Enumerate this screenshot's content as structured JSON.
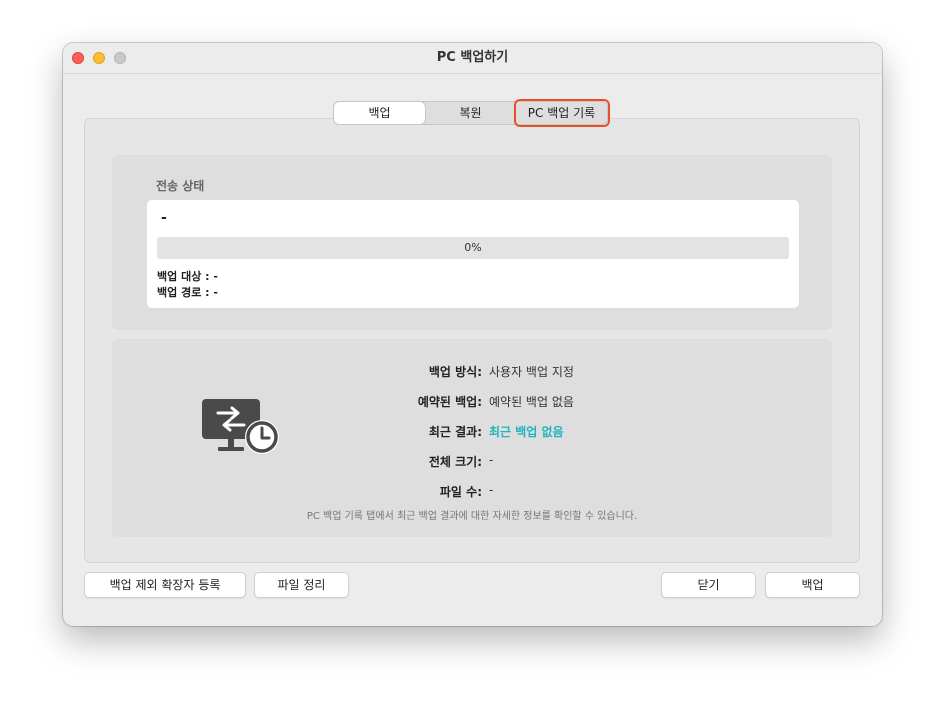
{
  "window": {
    "title": "PC 백업하기"
  },
  "tabs": [
    {
      "label": "백업",
      "active": true
    },
    {
      "label": "복원",
      "active": false
    },
    {
      "label": "PC 백업 기록",
      "active": false
    }
  ],
  "transfer": {
    "heading": "전송 상태",
    "current_item": "-",
    "progress_percent": 0,
    "progress_label": "0%",
    "target_line": "백업 대상 : -",
    "path_line": "백업 경로 : -"
  },
  "summary": {
    "rows": [
      {
        "label": "백업 방식:",
        "value": "사용자 백업 지정"
      },
      {
        "label": "예약된 백업:",
        "value": "예약된 백업 없음"
      },
      {
        "label": "최근 결과:",
        "value": "최근 백업 없음"
      },
      {
        "label": "전체 크기:",
        "value": "-"
      },
      {
        "label": "파일 수:",
        "value": "-"
      }
    ],
    "note": "PC 백업 기록 탭에서 최근 백업 결과에 대한 자세한 정보를 확인할 수 있습니다.",
    "accent_color": "#1fb4be",
    "icon": "monitor-sync-clock-icon"
  },
  "buttons": {
    "exclude_ext": "백업 제외 확장자 등록",
    "file_cleanup": "파일 정리",
    "close": "닫기",
    "backup": "백업"
  },
  "colors": {
    "highlight": "#e8502c",
    "progress": "#2aa6c4"
  }
}
